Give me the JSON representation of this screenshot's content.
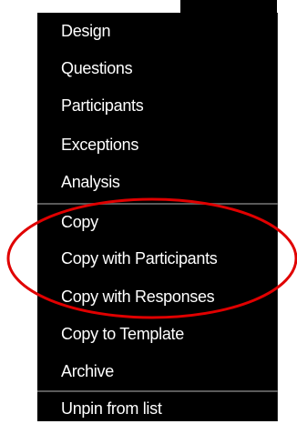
{
  "menu": {
    "items": [
      {
        "id": "design",
        "label": "Design"
      },
      {
        "id": "questions",
        "label": "Questions"
      },
      {
        "id": "participants",
        "label": "Participants"
      },
      {
        "id": "exceptions",
        "label": "Exceptions"
      },
      {
        "id": "analysis",
        "label": "Analysis"
      },
      {
        "id": "copy",
        "label": "Copy"
      },
      {
        "id": "copy-with-participants",
        "label": "Copy with Participants"
      },
      {
        "id": "copy-with-responses",
        "label": "Copy with Responses"
      },
      {
        "id": "copy-to-template",
        "label": "Copy to Template"
      },
      {
        "id": "archive",
        "label": "Archive"
      },
      {
        "id": "unpin-from-list",
        "label": "Unpin from list"
      }
    ]
  },
  "colors": {
    "menu_background": "#000000",
    "menu_text": "#ffffff",
    "divider": "#5a5a5a",
    "annotation": "#e00000"
  }
}
